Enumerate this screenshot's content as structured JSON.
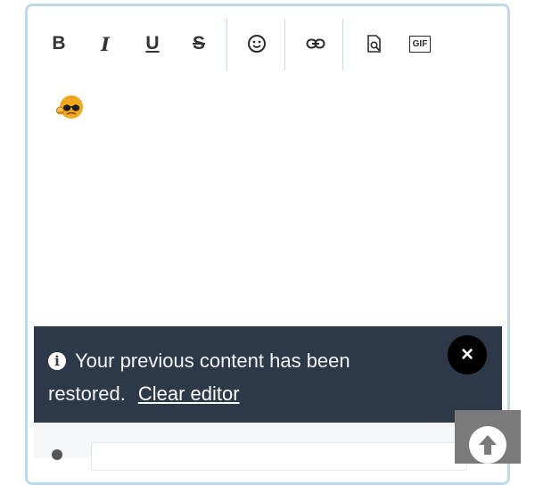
{
  "toolbar": {
    "bold_label": "B",
    "italic_label": "I",
    "underline_label": "U",
    "strike_label": "S",
    "emoji_icon": "smiley-icon",
    "link_icon": "link-icon",
    "preview_icon": "document-search-icon",
    "gif_label": "GIF"
  },
  "editor": {
    "content_emoji": "sunglasses-sweat-emoji"
  },
  "notice": {
    "message": "Your previous content has been restored.",
    "link_label": "Clear editor",
    "close_label": "×",
    "info_label": "i"
  },
  "colors": {
    "notice_bg": "#2d3848",
    "editor_border": "#bcd8ec",
    "scroll_button_bg": "#7a7a7a"
  }
}
